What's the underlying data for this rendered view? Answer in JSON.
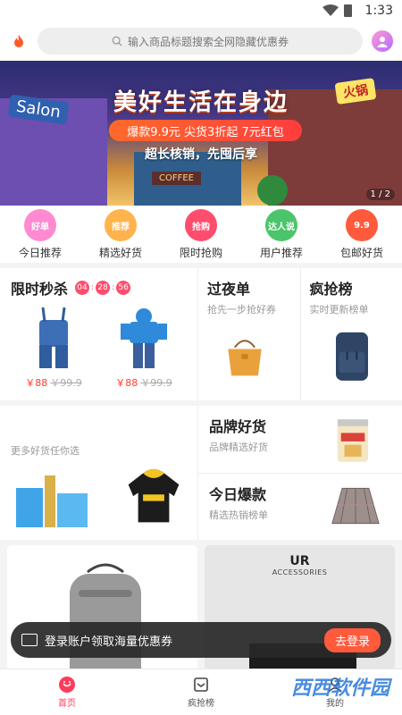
{
  "status": {
    "time": "1:33"
  },
  "search": {
    "placeholder": "输入商品标题搜索全网隐藏优惠券",
    "avatar_text": "头像"
  },
  "banner": {
    "title": "美好生活在身边",
    "promo": "爆款9.9元  尖货3折起  7元红包",
    "subtitle": "超长核销，先囤后享",
    "salon": "Salon",
    "huoguo": "火锅",
    "coffee": "COFFEE",
    "pager": "1 / 2"
  },
  "quick_nav": [
    {
      "label": "今日推荐",
      "badge": "好单",
      "color": "#ff8ad1"
    },
    {
      "label": "精选好货",
      "badge": "推荐",
      "color": "#ffb34d"
    },
    {
      "label": "限时抢购",
      "badge": "抢购",
      "color": "#ff4d6d"
    },
    {
      "label": "用户推荐",
      "badge": "达人说",
      "color": "#4cc46b"
    },
    {
      "label": "包邮好货",
      "badge": "9.9",
      "color": "#ff5a3c"
    }
  ],
  "flash_sale": {
    "title": "限时秒杀",
    "timer": [
      "04",
      "28",
      "56"
    ],
    "items": [
      {
        "price": "￥88",
        "old_price": "￥99.9"
      },
      {
        "price": "￥88",
        "old_price": "￥99.9"
      }
    ]
  },
  "tiles": {
    "overnight": {
      "title": "过夜单",
      "sub": "抢先一步抢好券"
    },
    "rush": {
      "title": "疯抢榜",
      "sub": "实时更新榜单"
    },
    "more": {
      "sub": "更多好货任你选"
    },
    "brand": {
      "title": "品牌好货",
      "sub": "品牌精选好货"
    },
    "hot": {
      "title": "今日爆款",
      "sub": "精选热销榜单"
    }
  },
  "cards": {
    "ur_title": "UR",
    "ur_sub": "ACCESSORIES"
  },
  "toast": {
    "text": "登录账户领取海量优惠券",
    "button": "去登录"
  },
  "tabbar": [
    {
      "label": "首页"
    },
    {
      "label": "疯抢榜"
    },
    {
      "label": "我的"
    }
  ],
  "watermark": "西西软件园",
  "colors": {
    "accent": "#ff3b5c",
    "timer": "#ff4d6d",
    "price": "#ff3b30"
  }
}
